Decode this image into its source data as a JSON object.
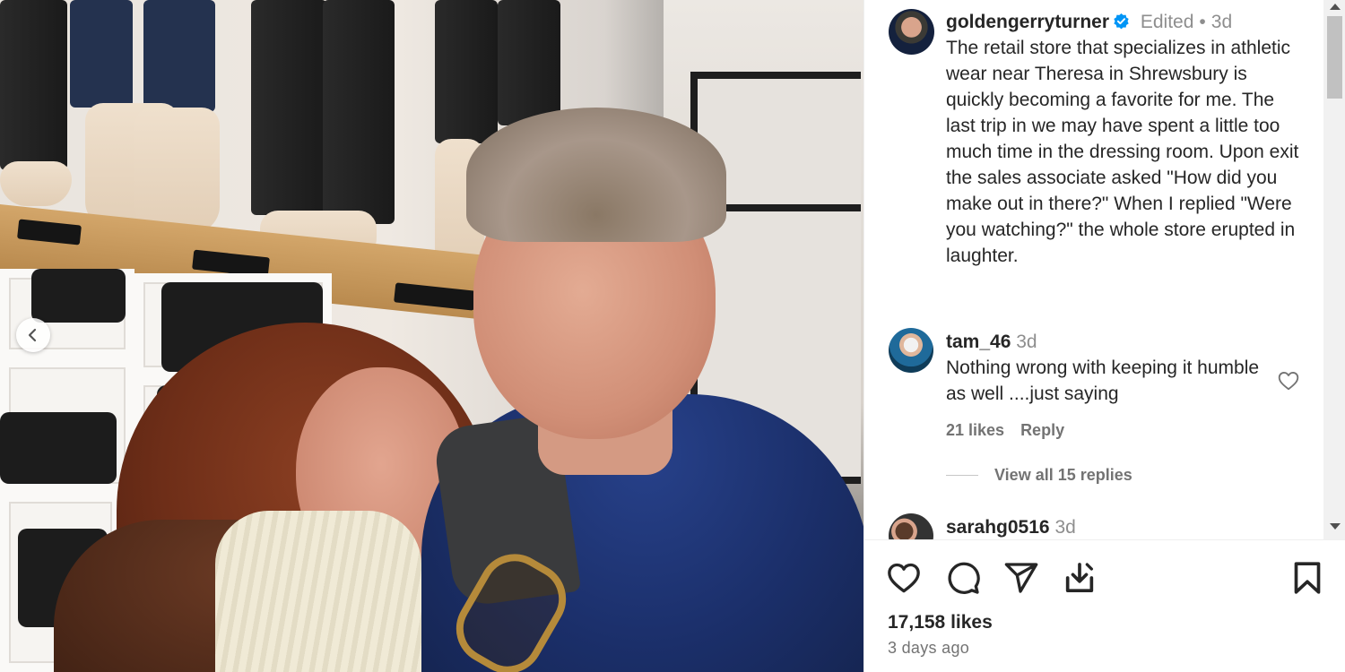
{
  "post": {
    "author": {
      "username": "goldengerryturner",
      "verified": true,
      "edited_label": "Edited",
      "separator": "•",
      "time": "3d"
    },
    "caption": "The retail store that specializes in athletic wear near Theresa in Shrewsbury is quickly becoming a favorite for me. The last trip in we may have spent a little too much time in the dressing room. Upon exit the sales associate asked \"How did you make out in there?\" When I replied \"Were you watching?\" the whole store erupted in laughter.",
    "comments": [
      {
        "username": "tam_46",
        "time": "3d",
        "text": "Nothing wrong with keeping it humble as well ....just saying",
        "likes_label": "21 likes",
        "reply_label": "Reply",
        "view_replies_label": "View all 15 replies"
      },
      {
        "username": "sarahg0516",
        "time": "3d"
      }
    ],
    "likes_label": "17,158 likes",
    "timestamp": "3 days ago"
  },
  "icons": {
    "verified": "verified-badge-icon",
    "heart": "heart-icon",
    "comment": "comment-icon",
    "share": "share-icon",
    "save_to_collection": "download-icon",
    "bookmark": "bookmark-icon",
    "carousel_prev": "chevron-left-icon"
  },
  "colors": {
    "verified_blue": "#0095f6",
    "text_primary": "#262626",
    "text_secondary": "#737373"
  }
}
